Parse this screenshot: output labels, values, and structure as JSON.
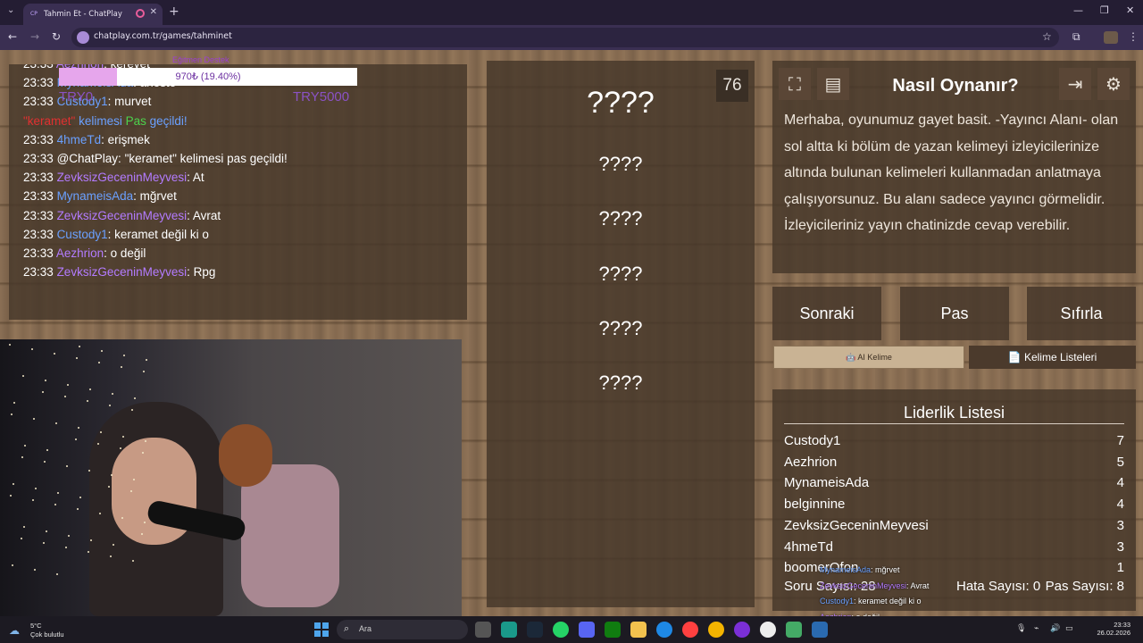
{
  "browser": {
    "tab_title": "Tahmin Et - ChatPlay",
    "tab_favicon": "CP",
    "url": "chatplay.com.tr/games/tahminet"
  },
  "overlay": {
    "title": "Eğitmen Destek",
    "progress_text": "970₺ (19.40%)",
    "progress_fraction": 0.194,
    "left_label": "TRY0",
    "right_label": "TRY5000"
  },
  "chat": [
    {
      "time": "23:33",
      "user": "Aezhrion",
      "sep": ": ",
      "msg": "kerevet",
      "color": "purple"
    },
    {
      "time": "23:33",
      "user": "MynameisAda",
      "sep": ": ",
      "msg": "aheste",
      "color": "blue"
    },
    {
      "time": "23:33",
      "user": "Custody1",
      "sep": ": ",
      "msg": "murvet",
      "color": "blue"
    },
    {
      "system": true,
      "word": "\"keramet\"",
      "mid": " kelimesi ",
      "pas": "Pas",
      "end": " geçildi!"
    },
    {
      "time": "23:33",
      "user": "4hmeTd",
      "sep": ": ",
      "msg": "erişmek",
      "color": "blue"
    },
    {
      "time": "23:33",
      "user": "@ChatPlay",
      "sep": ": ",
      "msg": "\"keramet\" kelimesi pas geçildi!",
      "color": "white"
    },
    {
      "time": "23:33",
      "user": "ZevksizGeceninMeyvesi",
      "sep": ": ",
      "msg": "At",
      "color": "purple"
    },
    {
      "time": "23:33",
      "user": "MynameisAda",
      "sep": ": ",
      "msg": "mğrvet",
      "color": "blue"
    },
    {
      "time": "23:33",
      "user": "ZevksizGeceninMeyvesi",
      "sep": ": ",
      "msg": "Avrat",
      "color": "purple"
    },
    {
      "time": "23:33",
      "user": "Custody1",
      "sep": ": ",
      "msg": "keramet değil ki o",
      "color": "blue"
    },
    {
      "time": "23:33",
      "user": "Aezhrion",
      "sep": ": ",
      "msg": "o değil",
      "color": "purple"
    },
    {
      "time": "23:33",
      "user": "ZevksizGeceninMeyvesi",
      "sep": ": ",
      "msg": "Rpg",
      "color": "purple"
    }
  ],
  "words": {
    "counter": "76",
    "main": "????",
    "items": [
      "????",
      "????",
      "????",
      "????",
      "????"
    ]
  },
  "howto": {
    "title": "Nasıl Oynanır?",
    "text": "Merhaba, oyunumuz gayet basit. -Yayıncı Alanı- olan sol altta ki bölüm de yazan kelimeyi izleyicilerinize altında bulunan kelimeleri kullanmadan anlatmaya çalışıyorsunuz. Bu alanı sadece yayıncı görmelidir. İzleyicileriniz yayın chatinizde cevap verebilir.",
    "icons": [
      "fullscreen-icon",
      "document-icon",
      "exit-icon",
      "gear-icon"
    ]
  },
  "actions": {
    "next": "Sonraki",
    "pass": "Pas",
    "reset": "Sıfırla",
    "ai_word": "🤖 AI Kelime",
    "word_lists": "📄 Kelime Listeleri"
  },
  "leaderboard": {
    "title": "Liderlik Listesi",
    "rows": [
      {
        "name": "Custody1",
        "score": "7"
      },
      {
        "name": "Aezhrion",
        "score": "5"
      },
      {
        "name": "MynameisAda",
        "score": "4"
      },
      {
        "name": "belginnine",
        "score": "4"
      },
      {
        "name": "ZevksizGeceninMeyvesi",
        "score": "3"
      },
      {
        "name": "4hmeTd",
        "score": "3"
      },
      {
        "name": "boomerOfon",
        "score": "1"
      }
    ],
    "question_count": "Soru Sayısı: 28",
    "error_count": "Hata Sayısı: 0",
    "pass_count": "Pas Sayısı: 8"
  },
  "floating_chat": [
    {
      "user": "MynameisAda",
      "msg": ": mğrvet",
      "color": "#6aa0ff"
    },
    {
      "user": "ZevksizGeceninMeyvesi",
      "msg": ": Avrat",
      "color": "#b37bff"
    },
    {
      "user": "Custody1",
      "msg": ": keramet değil ki o",
      "color": "#6aa0ff"
    },
    {
      "user": "Aezhrion",
      "msg": ": o değil",
      "color": "#b37bff"
    },
    {
      "user": "ZevksizGeceninMeyvesi",
      "msg": ": Rpg",
      "color": "#b37bff"
    }
  ],
  "taskbar": {
    "temp": "5°C",
    "weather": "Çok bulutlu",
    "search": "Ara",
    "time": "23:33",
    "date": "26.02.2026"
  }
}
